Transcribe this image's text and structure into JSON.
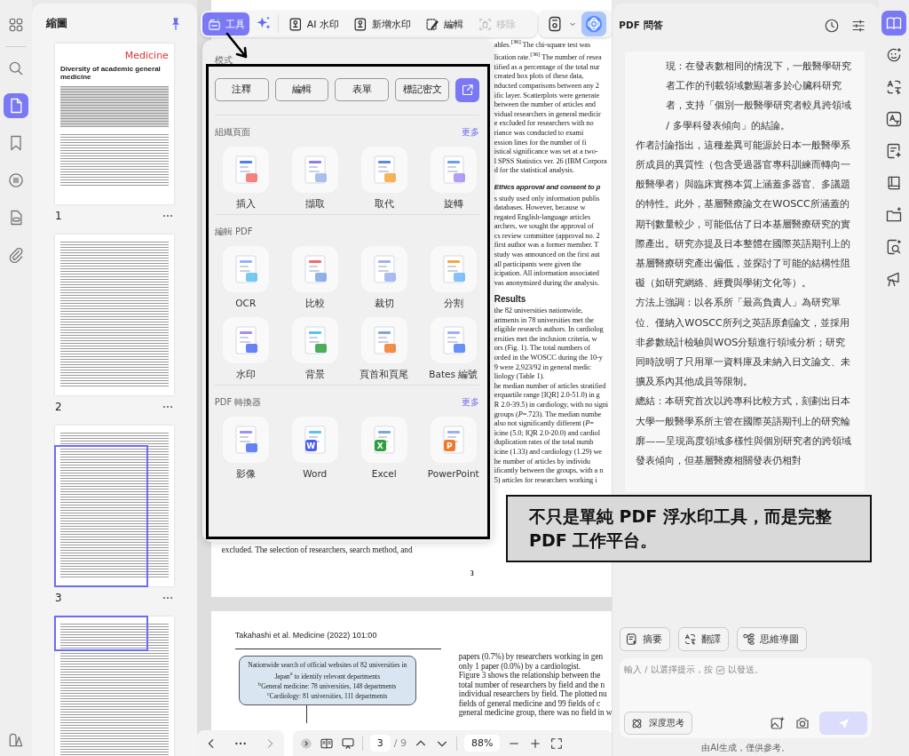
{
  "left_rail": {
    "items": [
      {
        "selected": false
      },
      {
        "selected": false
      },
      {
        "selected": true
      },
      {
        "selected": false
      },
      {
        "selected": false
      },
      {
        "selected": false
      },
      {
        "selected": false
      }
    ]
  },
  "thumbnails": {
    "title": "縮圖",
    "pages": [
      {
        "number": "1",
        "in_view": false,
        "logo": "Medicine",
        "heading": "Diversity of academic general medicine"
      },
      {
        "number": "2",
        "in_view": false
      },
      {
        "number": "3",
        "in_view": true
      },
      {
        "in_view": true
      }
    ]
  },
  "toolbar": {
    "items": [
      {
        "label": "工具",
        "selected": true,
        "disabled": false
      },
      {
        "label": "AI 水印",
        "selected": false,
        "disabled": false
      },
      {
        "label": "新增水印",
        "selected": false,
        "disabled": false
      },
      {
        "label": "編輯",
        "selected": false,
        "disabled": false
      },
      {
        "label": "移除",
        "selected": false,
        "disabled": true
      }
    ]
  },
  "tools_menu": {
    "mode_label": "模式",
    "modes": [
      "注釋",
      "編輯",
      "表單",
      "標記密文"
    ],
    "sections": [
      {
        "title": "組織頁面",
        "more": "更多",
        "tools": [
          {
            "label": "插入"
          },
          {
            "label": "擷取"
          },
          {
            "label": "取代"
          },
          {
            "label": "旋轉"
          }
        ]
      },
      {
        "title": "編輯 PDF",
        "tools": [
          {
            "label": "OCR"
          },
          {
            "label": "比較"
          },
          {
            "label": "裁切"
          },
          {
            "label": "分割"
          },
          {
            "label": "水印"
          },
          {
            "label": "背景"
          },
          {
            "label": "頁首和頁尾"
          },
          {
            "label": "Bates 編號"
          }
        ]
      },
      {
        "title": "PDF 轉換器",
        "more": "更多",
        "tools": [
          {
            "label": "影像"
          },
          {
            "label": "Word",
            "badge": "W"
          },
          {
            "label": "Excel",
            "badge": "X"
          },
          {
            "label": "PowerPoint",
            "badge": "P"
          }
        ]
      }
    ]
  },
  "document": {
    "page3": {
      "left_lines": [
        "excluded. The selection of researchers, search method, and"
      ],
      "page_number": "3",
      "right_lines": [
        {
          "kind": "text",
          "text": "ables.$^{[36]}$ The chi-square test was"
        },
        {
          "kind": "text",
          "text": "lication rate.$^{[36]}$ The number of resea"
        },
        {
          "kind": "text",
          "text": "tified as a percentage of the total nur"
        },
        {
          "kind": "text",
          "text": "created box plots of these data,"
        },
        {
          "kind": "text",
          "text": "nducted comparisons between any 2"
        },
        {
          "kind": "text",
          "text": "ific layer. Scatterplots were generate"
        },
        {
          "kind": "text",
          "text": "between the number of articles and"
        },
        {
          "kind": "text",
          "text": "vidual researchers in general medicir"
        },
        {
          "kind": "text",
          "text": "e excluded for researchers with no"
        },
        {
          "kind": "text",
          "text": "riance was conducted to exami"
        },
        {
          "kind": "text",
          "text": "ession lines for the number of fi"
        },
        {
          "kind": "text",
          "text": "istical significance was set at a two-"
        },
        {
          "kind": "text",
          "text": "l SPSS Statistics ver. 26 (IBM Corpora"
        },
        {
          "kind": "text",
          "text": "d for the statistical analysis."
        },
        {
          "kind": "subheading",
          "text": "Ethics approval and consent to p"
        },
        {
          "kind": "text",
          "text": "s study used only information publis"
        },
        {
          "kind": "text",
          "text": "databases. However, because w"
        },
        {
          "kind": "text",
          "text": "regated English-language articles"
        },
        {
          "kind": "text",
          "text": "archers, we sought the approval of"
        },
        {
          "kind": "text",
          "text": "cs review committee (approval no. 2"
        },
        {
          "kind": "text",
          "text": "first author was a former member. T"
        },
        {
          "kind": "text",
          "text": "study was announced on the first aut"
        },
        {
          "kind": "text",
          "text": "all participants were given the"
        },
        {
          "kind": "text",
          "text": "icipation. All information associated"
        },
        {
          "kind": "text",
          "text": "vas anonymized during the analysis."
        },
        {
          "kind": "heading",
          "text": "Results"
        },
        {
          "kind": "text",
          "text": "the 82 universities nationwide,"
        },
        {
          "kind": "text",
          "text": "artments in 78 universities met the"
        },
        {
          "kind": "text",
          "text": "eligible research authors. In cardiolog"
        },
        {
          "kind": "text",
          "text": "ersities met the inclusion criteria, w"
        },
        {
          "kind": "text",
          "text": "ors (Fig. 1). The total numbers of"
        },
        {
          "kind": "text",
          "text": "orded in the WOSCC during the 10-y"
        },
        {
          "kind": "text",
          "text": "9 were 2,923/92 in general medic"
        },
        {
          "kind": "text",
          "text": "liology (Table 1)."
        },
        {
          "kind": "text",
          "text": "he median number of articles stratified"
        },
        {
          "kind": "text",
          "text": "erquartile range [IQR] 2.0-51.0) in g"
        },
        {
          "kind": "text",
          "text": "R 2.0-39.5) in cardiology, with no signi"
        },
        {
          "kind": "text",
          "text": "groups (*P*=.723). The median numbe"
        },
        {
          "kind": "text",
          "text": "also not significantly different (*P*="
        },
        {
          "kind": "text",
          "text": "icine (5.0; IQR 2.0-20.0) and cardiol"
        },
        {
          "kind": "text",
          "text": "duplication rates of the total numb"
        },
        {
          "kind": "text",
          "text": "icine (1.33) and cardiology (1.29) we"
        },
        {
          "kind": "text",
          "text": "he number of articles by individu"
        },
        {
          "kind": "text",
          "text": "ificantly between the groups, with a n"
        },
        {
          "kind": "text",
          "text": "5) articles for researchers working i"
        }
      ]
    },
    "page4": {
      "running_head": "Takahashi et al. Medicine (2022) 101:00",
      "flow_box": {
        "title": "Nationwide search of official websites of 82 universities in Japan$^{a}$ to identify relevant departments",
        "lines": [
          "$^{b}$General medicine: 78 universities, 148 departments",
          "$^{c}$Cardiology: 81 universities, 111 departments"
        ]
      },
      "right_lines": [
        "papers (0.7%) by researchers working in gen",
        "only 1 paper (0.0%) by a cardiologist.",
        "Figure 3 shows the relationship between the",
        "total number of researchers by field and the n",
        "individual researchers by field. The plotted nu",
        "fields of general medicine and 99 fields of c",
        "general medicine group, there was no field in w"
      ]
    }
  },
  "bottom_bar": {
    "page_input": "3",
    "page_total": "/ 9",
    "zoom": "88%"
  },
  "chat": {
    "title": "PDF 問答",
    "paragraphs": [
      {
        "indent": true,
        "text": "現：在發表數相同的情況下，一般醫學研究者工作的刊載領域數顯著多於心臟科研究者，支持「個別一般醫學研究者較具跨領域 / 多學科發表傾向」的結論。"
      },
      {
        "indent": false,
        "text": "作者討論指出，這種差異可能源於日本一般醫學系所成員的異質性（包含受過器官專科訓練而轉向一般醫學者）與臨床實務本質上涵蓋多器官、多議題的特性。此外，基層醫療論文在WOSCC所涵蓋的期刊數量較少，可能低估了日本基層醫療研究的實際產出。研究亦提及日本整體在國際英語期刊上的基層醫療研究產出偏低，並探討了可能的結構性阻礙（如研究網絡、經費與學術文化等）。"
      },
      {
        "indent": false,
        "text": "方法上強調：以各系所「最高負責人」為研究單位、僅納入WOSCC所列之英語原創論文，並採用非參數統計檢驗與WOS分類進行領域分析；研究同時說明了只用單一資料庫及未納入日文論文、未擴及系內其他成員等限制。"
      },
      {
        "indent": false,
        "text": "總結：本研究首次以跨專科比較方式，刻劃出日本大學一般醫學系所主管在國際英語期刊上的研究輪廓——呈現高度領域多樣性與個別研究者的跨領域發表傾向，但基層醫療相關發表仍相對"
      }
    ],
    "actions": [
      "摘要",
      "翻譯",
      "思維導圖"
    ],
    "input": {
      "placeholder_start": "輸入 / 以選擇提示，按",
      "placeholder_end": "以發送。"
    },
    "deep_think": "深度思考",
    "send": {
      "disabled": true
    },
    "footer": "由AI生成，僅供參考。"
  },
  "right_rail": {
    "items": [
      {
        "selected": true
      },
      {
        "selected": false
      },
      {
        "selected": false
      },
      {
        "selected": false
      },
      {
        "selected": false
      },
      {
        "selected": false
      },
      {
        "selected": false
      },
      {
        "selected": false
      },
      {
        "selected": false
      }
    ]
  },
  "callout": {
    "text": "不只是單純 PDF 浮水印工具，而是完整 PDF 工作平台。"
  }
}
